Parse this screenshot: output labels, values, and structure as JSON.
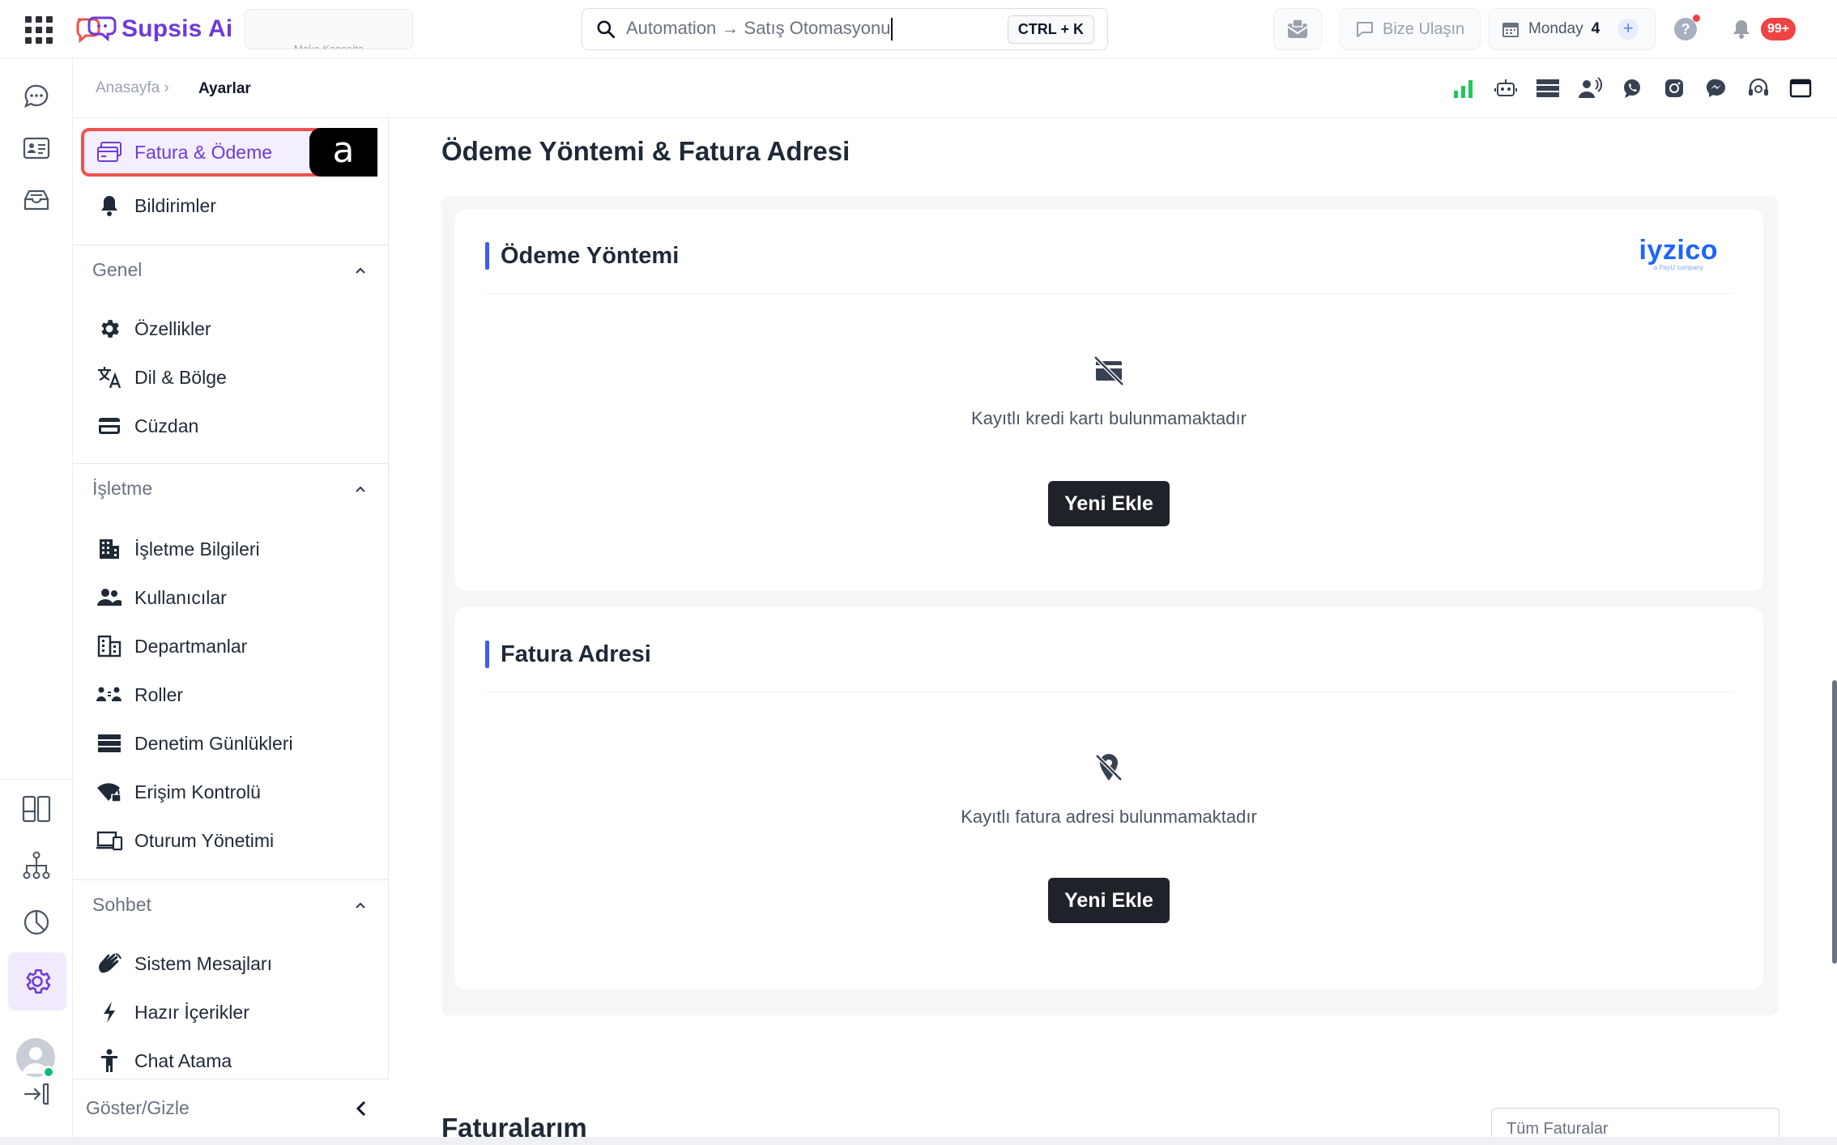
{
  "topbar": {
    "brand": "Supsis Ai",
    "workspace": "Maka Kansaita",
    "search_value": "Automation → Satış Otomasyonu",
    "search_shortcut": "CTRL + K",
    "contact_label": "Bize Ulaşın",
    "calendar_label": "Monday",
    "calendar_day": "4",
    "notification_count": "99+",
    "help_glyph": "?"
  },
  "breadcrumb": {
    "home": "Anasayfa ›",
    "current": "Ayarlar"
  },
  "sidebar": {
    "top_items": [
      {
        "label": "Fatura & Ödeme",
        "icon": "billing-icon"
      },
      {
        "label": "Bildirimler",
        "icon": "bell-icon"
      }
    ],
    "marker": "a",
    "sections": [
      {
        "title": "Genel",
        "items": [
          {
            "label": "Özellikler",
            "icon": "gear-icon"
          },
          {
            "label": "Dil & Bölge",
            "icon": "translate-icon"
          },
          {
            "label": "Cüzdan",
            "icon": "wallet-icon"
          }
        ]
      },
      {
        "title": "İşletme",
        "items": [
          {
            "label": "İşletme Bilgileri",
            "icon": "building-icon"
          },
          {
            "label": "Kullanıcılar",
            "icon": "users-icon"
          },
          {
            "label": "Departmanlar",
            "icon": "departments-icon"
          },
          {
            "label": "Roller",
            "icon": "roles-icon"
          },
          {
            "label": "Denetim Günlükleri",
            "icon": "logs-icon"
          },
          {
            "label": "Erişim Kontrolü",
            "icon": "access-icon"
          },
          {
            "label": "Oturum Yönetimi",
            "icon": "devices-icon"
          }
        ]
      },
      {
        "title": "Sohbet",
        "items": [
          {
            "label": "Sistem Mesajları",
            "icon": "wave-icon"
          },
          {
            "label": "Hazır İçerikler",
            "icon": "bolt-icon"
          },
          {
            "label": "Chat Atama",
            "icon": "person-icon"
          }
        ]
      }
    ],
    "toggle_label": "Göster/Gizle"
  },
  "main": {
    "title": "Ödeme Yöntemi & Fatura Adresi",
    "payment": {
      "heading": "Ödeme Yöntemi",
      "provider": "iyzico",
      "provider_sub": "a PayU company",
      "empty_text": "Kayıtlı kredi kartı bulunmamaktadır",
      "button": "Yeni Ekle"
    },
    "address": {
      "heading": "Fatura Adresi",
      "empty_text": "Kayıtlı fatura adresi bulunmamaktadır",
      "button": "Yeni Ekle"
    },
    "invoices_title": "Faturalarım",
    "invoices_filter": "Tüm Faturalar"
  },
  "colors": {
    "brand": "#6d3bd8",
    "accent": "#3b5bfd",
    "highlight": "#ef5350",
    "dark_button": "#1f2228"
  }
}
